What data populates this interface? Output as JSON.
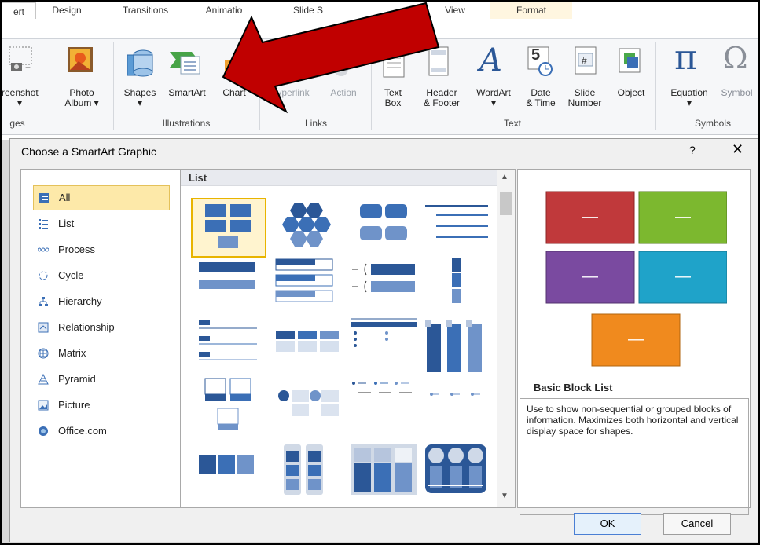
{
  "ribbon": {
    "tabs": [
      "ert",
      "Design",
      "Transitions",
      "Animatio",
      "Slide S",
      "View",
      "Format"
    ],
    "buttons": {
      "screenshot": "reenshot\n▾",
      "photo_album": "Photo\nAlbum ▾",
      "shapes": "Shapes\n▾",
      "smartart": "SmartArt",
      "chart": "Chart",
      "hyperlink": "yperlink",
      "action": "Action",
      "text_box": "Text\nBox",
      "header_footer": "Header\n& Footer",
      "wordart": "WordArt\n▾",
      "date_time": "Date\n& Time",
      "slide_number": "Slide\nNumber",
      "object": "Object",
      "equation": "Equation\n▾",
      "symbol": "Symbol"
    },
    "groups": {
      "images": "ges",
      "illustrations": "Illustrations",
      "links": "Links",
      "text": "Text",
      "symbols": "Symbols"
    },
    "date_glyph": "5",
    "number_glyph": "#",
    "pi_glyph": "π",
    "omega_glyph": "Ω",
    "wordart_glyph": "A"
  },
  "dialog": {
    "title": "Choose a SmartArt Graphic",
    "help": "?",
    "close": "✕",
    "categories": [
      {
        "label": "All",
        "icon": "all-icon",
        "selected": true
      },
      {
        "label": "List",
        "icon": "list-icon"
      },
      {
        "label": "Process",
        "icon": "process-icon"
      },
      {
        "label": "Cycle",
        "icon": "cycle-icon"
      },
      {
        "label": "Hierarchy",
        "icon": "hierarchy-icon"
      },
      {
        "label": "Relationship",
        "icon": "relationship-icon"
      },
      {
        "label": "Matrix",
        "icon": "matrix-icon"
      },
      {
        "label": "Pyramid",
        "icon": "pyramid-icon"
      },
      {
        "label": "Picture",
        "icon": "picture-icon"
      },
      {
        "label": "Office.com",
        "icon": "office-icon"
      }
    ],
    "gallery_heading": "List",
    "preview": {
      "title": "Basic Block List",
      "description": "Use to show non-sequential or grouped blocks of information. Maximizes both horizontal and vertical display space for shapes.",
      "block_colors": [
        "#c0393b",
        "#7cb82f",
        "#7a4aa0",
        "#1fa3c9",
        "#f08a1e"
      ],
      "dash": "—"
    },
    "ok_label": "OK",
    "cancel_label": "Cancel"
  },
  "colors": {
    "accent_blue": "#2b5797",
    "selection_yellow": "#fde9a9",
    "arrow_red": "#c00000"
  }
}
